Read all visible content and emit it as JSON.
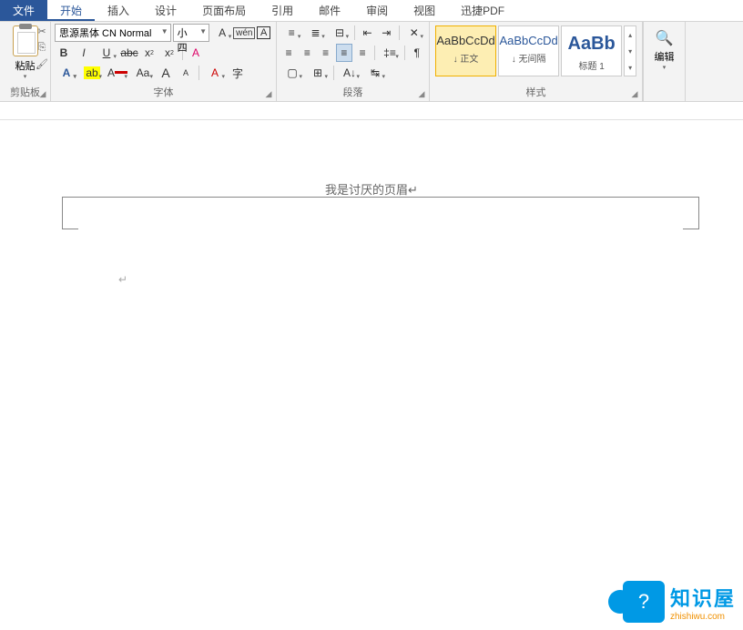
{
  "tabs": {
    "file": "文件",
    "home": "开始",
    "insert": "插入",
    "design": "设计",
    "layout": "页面布局",
    "references": "引用",
    "mail": "邮件",
    "review": "审阅",
    "view": "视图",
    "pdf": "迅捷PDF"
  },
  "clipboard": {
    "paste": "粘贴",
    "label": "剪贴板"
  },
  "font": {
    "name": "思源黑体 CN Normal",
    "size": "小四",
    "label": "字体",
    "pinyin_char": "wén",
    "boxed_char": "A",
    "clear_char": "A"
  },
  "paragraph": {
    "label": "段落"
  },
  "styles": {
    "label": "样式",
    "items": [
      {
        "preview": "AaBbCcDd",
        "name": "↓ 正文"
      },
      {
        "preview": "AaBbCcDd",
        "name": "↓ 无间隔"
      },
      {
        "preview": "AaBb",
        "name": "标题 1"
      }
    ]
  },
  "edit": {
    "label": "编辑"
  },
  "document": {
    "header_text": "我是讨厌的页眉↵"
  },
  "watermark": {
    "main": "知识屋",
    "sub": "zhishiwu.com",
    "badge": "?"
  }
}
